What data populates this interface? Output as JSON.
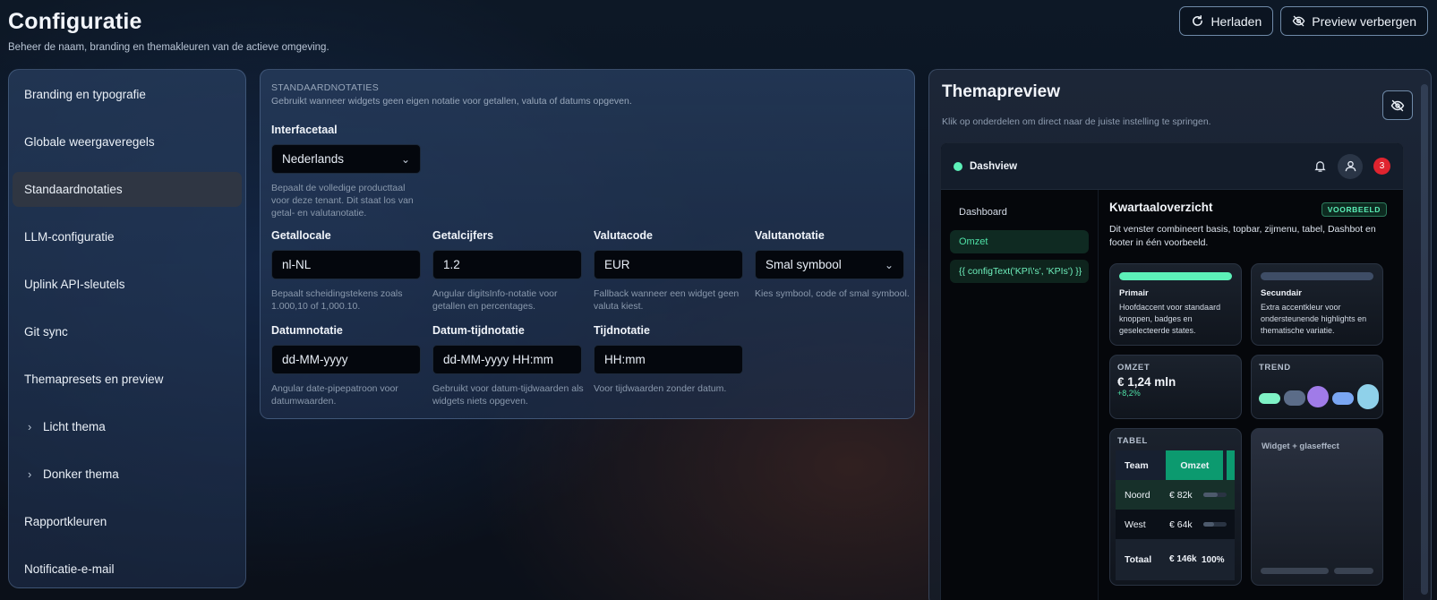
{
  "header": {
    "title": "Configuratie",
    "subtitle": "Beheer de naam, branding en themakleuren van de actieve omgeving.",
    "reload_label": "Herladen",
    "hide_preview_label": "Preview verbergen"
  },
  "sidebar": {
    "items": [
      {
        "label": "Branding en typografie"
      },
      {
        "label": "Globale weergaveregels"
      },
      {
        "label": "Standaardnotaties"
      },
      {
        "label": "LLM-configuratie"
      },
      {
        "label": "Uplink API-sleutels"
      },
      {
        "label": "Git sync"
      },
      {
        "label": "Themapresets en preview"
      },
      {
        "label": "Licht thema"
      },
      {
        "label": "Donker thema"
      },
      {
        "label": "Rapportkleuren"
      },
      {
        "label": "Notificatie-e-mail"
      }
    ]
  },
  "notations": {
    "eyebrow": "STANDAARDNOTATIES",
    "description": "Gebruikt wanneer widgets geen eigen notatie voor getallen, valuta of datums opgeven.",
    "interface_language": {
      "label": "Interfacetaal",
      "value": "Nederlands",
      "help": "Bepaalt de volledige producttaal voor deze tenant. Dit staat los van getal- en valutanotatie."
    },
    "number_locale": {
      "label": "Getallocale",
      "value": "nl-NL",
      "help": "Bepaalt scheidingstekens zoals 1.000,10 of 1,000.10."
    },
    "number_digits": {
      "label": "Getalcijfers",
      "value": "1.2",
      "help": "Angular digitsInfo-notatie voor getallen en percentages."
    },
    "currency_code": {
      "label": "Valutacode",
      "value": "EUR",
      "help": "Fallback wanneer een widget geen valuta kiest."
    },
    "currency_notation": {
      "label": "Valutanotatie",
      "value": "Smal symbool",
      "help": "Kies symbool, code of smal symbool."
    },
    "date_notation": {
      "label": "Datumnotatie",
      "value": "dd-MM-yyyy",
      "help": "Angular date-pipepatroon voor datumwaarden."
    },
    "datetime_notation": {
      "label": "Datum-tijdnotatie",
      "value": "dd-MM-yyyy HH:mm",
      "help": "Gebruikt voor datum-tijdwaarden als widgets niets opgeven."
    },
    "time_notation": {
      "label": "Tijdnotatie",
      "value": "HH:mm",
      "help": "Voor tijdwaarden zonder datum."
    }
  },
  "preview": {
    "title": "Themapreview",
    "subtitle": "Klik op onderdelen om direct naar de juiste instelling te springen.",
    "app": {
      "brand": "Dashview",
      "notification_count": "3",
      "nav": [
        "Dashboard",
        "Omzet",
        "{{ configText('KPI\\'s', 'KPIs') }}"
      ],
      "main_title": "Kwartaaloverzicht",
      "badge": "VOORBEELD",
      "description": "Dit venster combineert basis, topbar, zijmenu, tabel, Dashbot en footer in één voorbeeld.",
      "primary": {
        "title": "Primair",
        "desc": "Hoofdaccent voor standaard knoppen, badges en geselecteerde states.",
        "color": "#5cf0b8"
      },
      "secondary": {
        "title": "Secundair",
        "desc": "Extra accentkleur voor ondersteunende highlights en thematische variatie.",
        "color": "#3e4d66"
      },
      "kpi": {
        "label": "OMZET",
        "value": "€ 1,24 mln",
        "delta": "+8,2%"
      },
      "trend": {
        "label": "TREND"
      },
      "table": {
        "label": "TABEL",
        "headers": [
          "Team",
          "Omzet"
        ],
        "rows": [
          {
            "team": "Noord",
            "value": "€ 82k",
            "share": 0.6
          },
          {
            "team": "West",
            "value": "€ 64k",
            "share": 0.45
          },
          {
            "team": "Totaal",
            "value": "€ 146k",
            "pct": "100%"
          }
        ]
      },
      "glass": {
        "label": "Widget + glaseffect"
      }
    }
  }
}
